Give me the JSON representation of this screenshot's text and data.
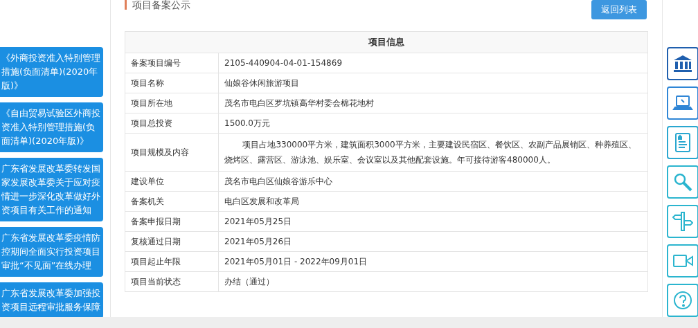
{
  "side_links": [
    {
      "text": "《外商投资准入特别管理措施(负面清单)(2020年版)》"
    },
    {
      "text": "《自由贸易试验区外商投资准入特别管理措施(负面清单)(2020年版)》"
    },
    {
      "text": "广东省发展改革委转发国家发展改革委关于应对疫情进一步深化改革做好外资项目有关工作的通知"
    },
    {
      "text": "广东省发展改革委疫情防控期间全面实行投资项目审批“不见面”在线办理"
    },
    {
      "text": "广东省发展改革委加强投资项目远程审批服务保障"
    }
  ],
  "section_title": "项目备案公示",
  "back_button": "返回列表",
  "table": {
    "title": "项目信息",
    "rows": [
      {
        "label": "备案项目编号",
        "value": "2105-440904-04-01-154869"
      },
      {
        "label": "项目名称",
        "value": "仙娘谷休闲旅游项目"
      },
      {
        "label": "项目所在地",
        "value": "茂名市电白区罗坑镇高华村委会棉花地村"
      },
      {
        "label": "项目总投资",
        "value": "1500.0万元"
      },
      {
        "label": "项目规模及内容",
        "value": "项目占地330000平方米，建筑面积3000平方米，主要建设民宿区、餐饮区、农副产品展销区、种养殖区、烧烤区、露营区、游泳池、娱乐室、会议室以及其他配套设施。年可接待游客480000人。",
        "kind": "paragraph"
      },
      {
        "label": "建设单位",
        "value": "茂名市电白区仙娘谷游乐中心"
      },
      {
        "label": "备案机关",
        "value": "电白区发展和改革局"
      },
      {
        "label": "备案申报日期",
        "value": "2021年05月25日"
      },
      {
        "label": "复核通过日期",
        "value": "2021年05月26日"
      },
      {
        "label": "项目起止年限",
        "value": "2021年05月01日 - 2022年09月01日"
      },
      {
        "label": "项目当前状态",
        "value": "办结（通过）"
      }
    ]
  },
  "side_tools": [
    {
      "kind": "building",
      "color": "#1f5fae"
    },
    {
      "kind": "laptop",
      "color": "#2f86d6"
    },
    {
      "kind": "document",
      "color": "#2aa7d0"
    },
    {
      "kind": "search",
      "color": "#2bb5cf"
    },
    {
      "kind": "signpost",
      "color": "#2bb5cf"
    },
    {
      "kind": "video",
      "color": "#2bb5cf"
    },
    {
      "kind": "help",
      "color": "#2bb5cf"
    }
  ]
}
